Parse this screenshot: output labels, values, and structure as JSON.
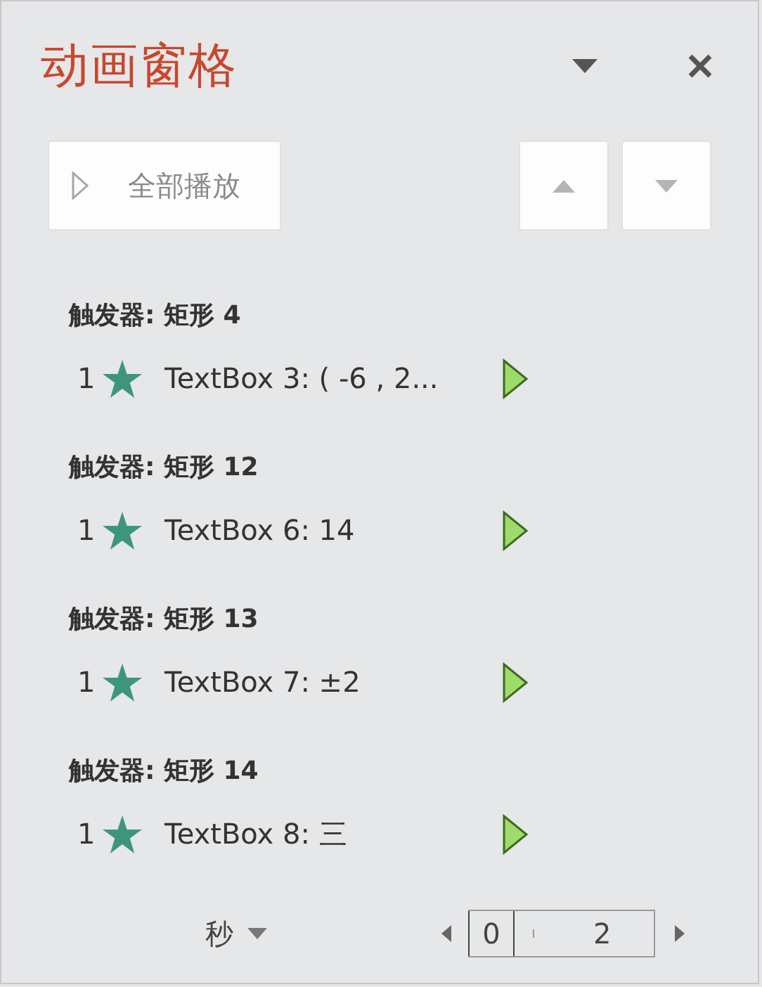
{
  "title": "动画窗格",
  "play_all_button": {
    "label": "全部播放"
  },
  "groups": [
    {
      "trigger": "触发器: 矩形 4",
      "items": [
        {
          "order": "1",
          "label": "TextBox 3: ( -6 , 2..."
        }
      ]
    },
    {
      "trigger": "触发器: 矩形 12",
      "items": [
        {
          "order": "1",
          "label": "TextBox 6: 14"
        }
      ]
    },
    {
      "trigger": "触发器: 矩形 13",
      "items": [
        {
          "order": "1",
          "label": "TextBox 7: ±2"
        }
      ]
    },
    {
      "trigger": "触发器: 矩形 14",
      "items": [
        {
          "order": "1",
          "label": "TextBox 8: 三"
        }
      ]
    }
  ],
  "timeline": {
    "unit": "秒",
    "start": "0",
    "end": "2"
  }
}
